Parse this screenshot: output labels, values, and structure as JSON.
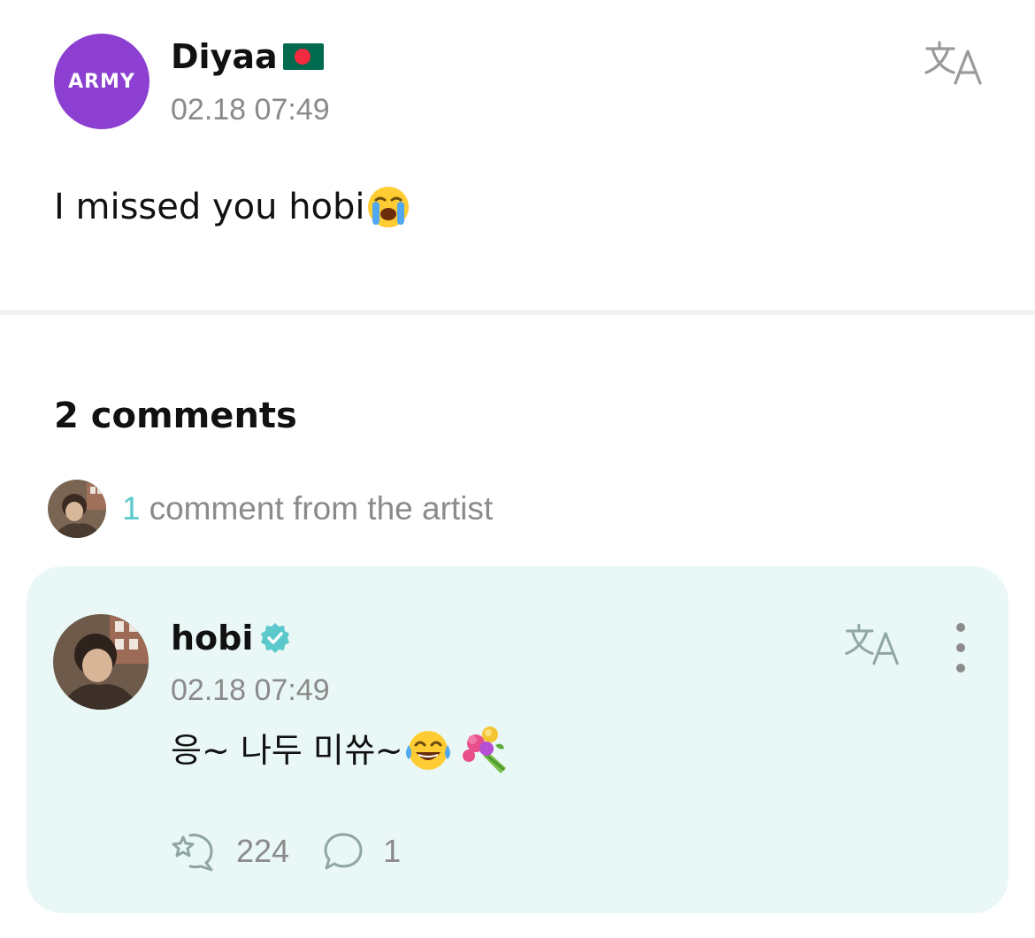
{
  "post": {
    "author_avatar_text": "ARMY",
    "author_name": "Diyaa",
    "author_flag_icon": "bangladesh-flag-icon",
    "timestamp": "02.18 07:49",
    "text": "I missed you hobi",
    "text_emoji": "loudly-crying-face",
    "translate_icon": "translate-icon"
  },
  "comments": {
    "count_label": "2 comments",
    "artist_summary": {
      "count": "1",
      "label": "comment from the artist"
    },
    "artist_comment": {
      "author_name": "hobi",
      "verified_icon": "verified-badge-icon",
      "timestamp": "02.18 07:49",
      "text": "응~ 나두 미쓔~",
      "emojis": [
        "face-with-tears-of-joy",
        "bouquet"
      ],
      "reactions_count": "224",
      "replies_count": "1"
    }
  },
  "colors": {
    "army_purple": "#8C3FD1",
    "accent_teal": "#5BC8CC",
    "card_bg": "#E9F8F6",
    "muted_text": "#8a8a8a"
  }
}
